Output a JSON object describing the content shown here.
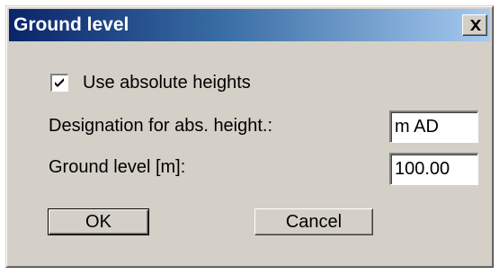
{
  "dialog": {
    "title": "Ground level",
    "close_glyph": "×"
  },
  "options": {
    "use_absolute_heights": {
      "label": "Use absolute heights",
      "checked": true
    }
  },
  "fields": {
    "designation": {
      "label": "Designation for abs. height.:",
      "value": "m AD"
    },
    "ground_level": {
      "label": "Ground level [m]:",
      "value": "100.00"
    }
  },
  "buttons": {
    "ok_label": "OK",
    "cancel_label": "Cancel"
  },
  "colors": {
    "face": "#d4d0c8",
    "title_start": "#0a246a",
    "title_end": "#a6caf0",
    "title_text": "#ffffff"
  },
  "icons": {
    "close": "close-icon",
    "check": "checkmark-icon"
  }
}
